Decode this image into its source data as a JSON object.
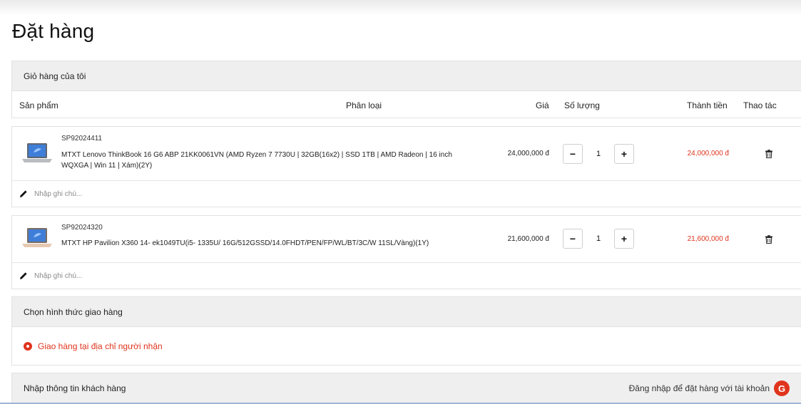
{
  "page": {
    "title": "Đặt hàng"
  },
  "cart": {
    "header": "Giỏ hàng của tôi",
    "columns": {
      "product": "Sản phẩm",
      "category": "Phân loại",
      "price": "Giá",
      "quantity": "Số lượng",
      "total": "Thành tiền",
      "action": "Thao tác"
    },
    "items": [
      {
        "sku": "SP92024411",
        "name": "MTXT Lenovo ThinkBook 16 G6 ABP 21KK0061VN (AMD Ryzen 7 7730U | 32GB(16x2) | SSD 1TB | AMD Radeon | 16 inch WQXGA | Win 11 | Xám)(2Y)",
        "price": "24,000,000 đ",
        "qty": "1",
        "total": "24,000,000 đ",
        "note_placeholder": "Nhập ghi chú..."
      },
      {
        "sku": "SP92024320",
        "name": "MTXT HP Pavilion X360 14- ek1049TU(i5- 1335U/ 16G/512GSSD/14.0FHDT/PEN/FP/WL/BT/3C/W 11SL/Vàng)(1Y)",
        "price": "21,600,000 đ",
        "qty": "1",
        "total": "21,600,000 đ",
        "note_placeholder": "Nhập ghi chú..."
      }
    ],
    "minus_label": "−",
    "plus_label": "+"
  },
  "shipping": {
    "header": "Chọn hình thức giao hàng",
    "option": "Giao hàng tại địa chỉ người nhận"
  },
  "customer": {
    "header": "Nhập thông tin khách hàng",
    "login_hint": "Đăng nhập để đặt hàng với tài khoản",
    "google_letter": "G"
  },
  "colors": {
    "accent": "#e0341d",
    "panel_header": "#efefef",
    "border": "#e2e2e2"
  },
  "icons": [
    "laptop-thumbnail",
    "trash-icon",
    "pencil-icon",
    "radio-selected-icon",
    "google-icon"
  ]
}
